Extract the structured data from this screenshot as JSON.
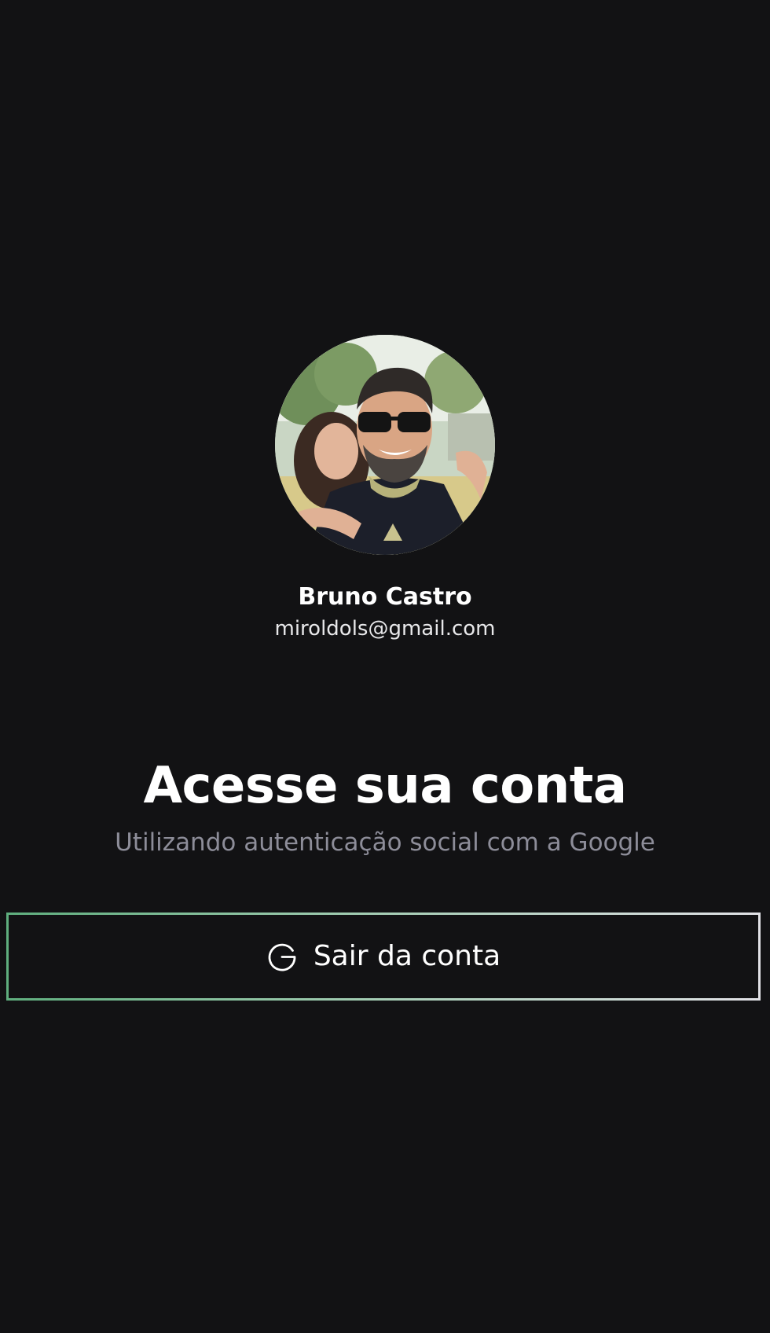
{
  "user": {
    "name": "Bruno Castro",
    "email": "miroldols@gmail.com",
    "avatar_icon": "profile-photo"
  },
  "auth": {
    "title": "Acesse sua conta",
    "subtitle": "Utilizando autenticação social com a Google",
    "signout_label": "Sair da conta",
    "signout_icon": "google-icon"
  },
  "colors": {
    "background": "#121214",
    "text_primary": "#ffffff",
    "text_secondary": "#8d8d99",
    "button_border_start": "#5fae7e",
    "button_border_end": "#e1e1e6"
  }
}
